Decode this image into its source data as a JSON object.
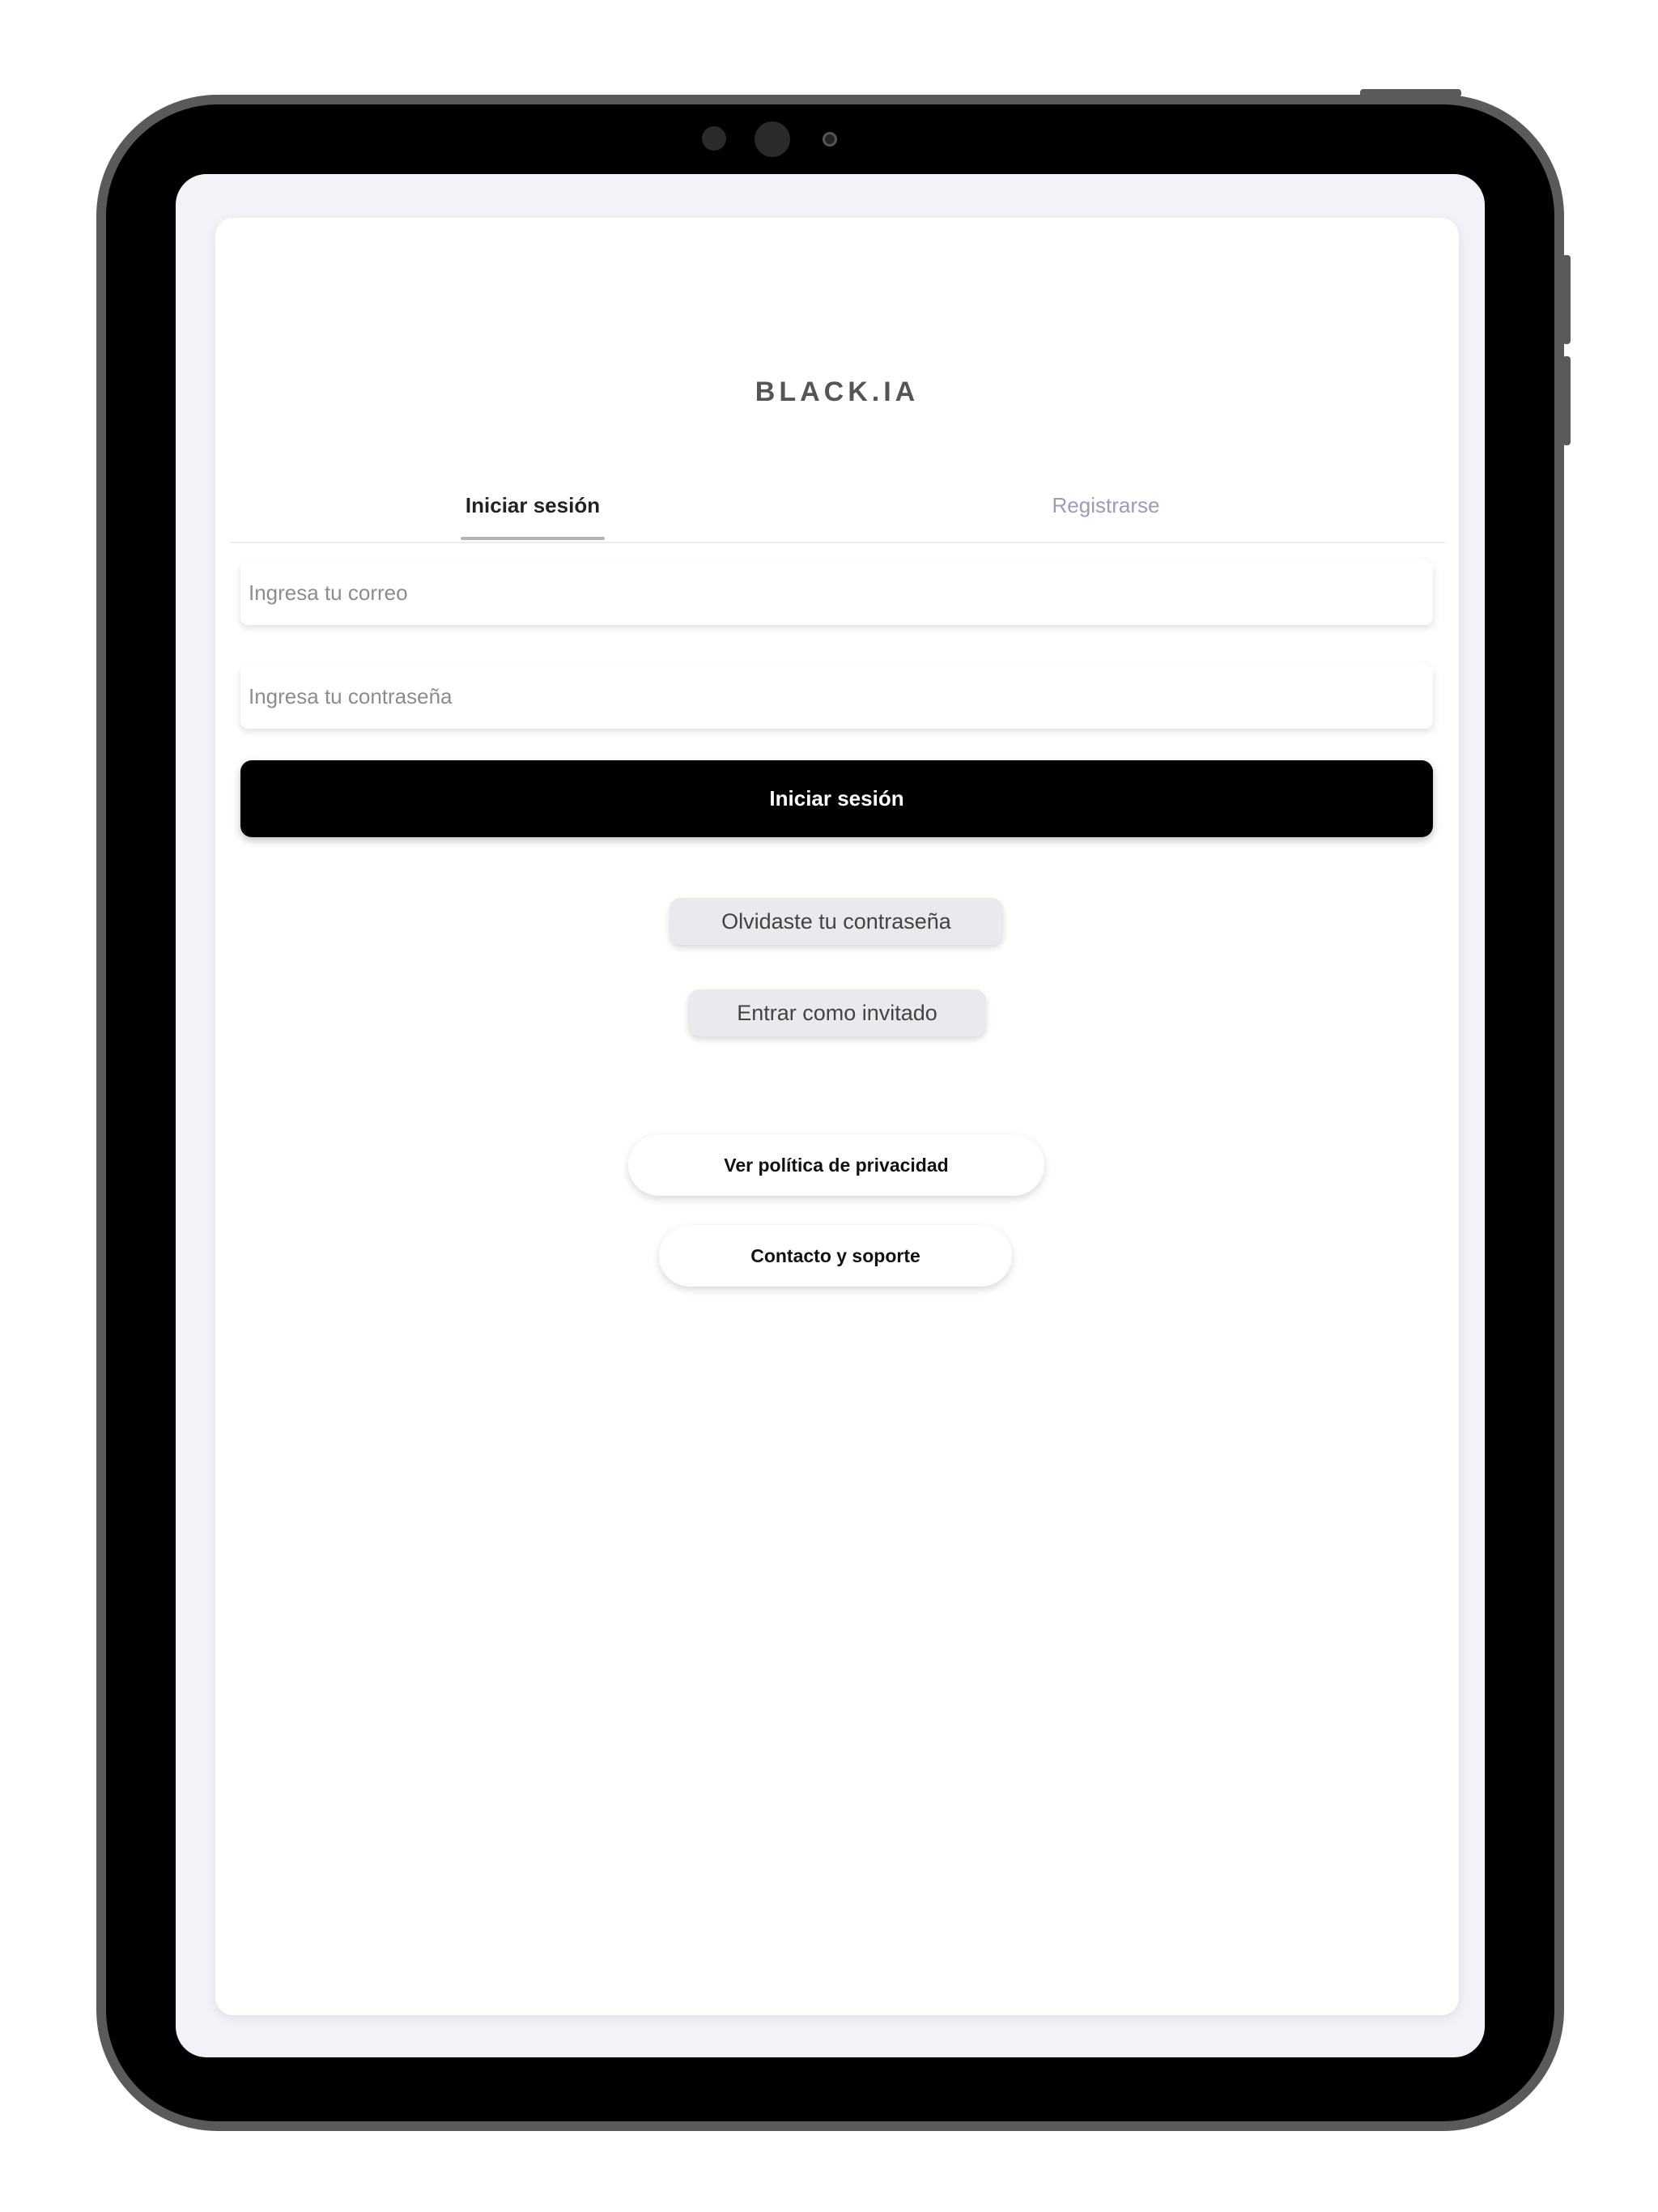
{
  "app": {
    "brand": "BLACK.IA"
  },
  "tabs": [
    {
      "label": "Iniciar sesión",
      "active": true
    },
    {
      "label": "Registrarse",
      "active": false
    }
  ],
  "form": {
    "email_placeholder": "Ingresa tu correo",
    "password_placeholder": "Ingresa tu contraseña",
    "submit_label": "Iniciar sesión"
  },
  "links": {
    "forgot_password": "Olvidaste tu contraseña",
    "guest": "Entrar como invitado",
    "privacy": "Ver política de privacidad",
    "support": "Contacto y soporte"
  },
  "colors": {
    "primary": "#000000",
    "inactive_tab": "#9a9cb8",
    "screen_background": "#f1f3f8"
  }
}
